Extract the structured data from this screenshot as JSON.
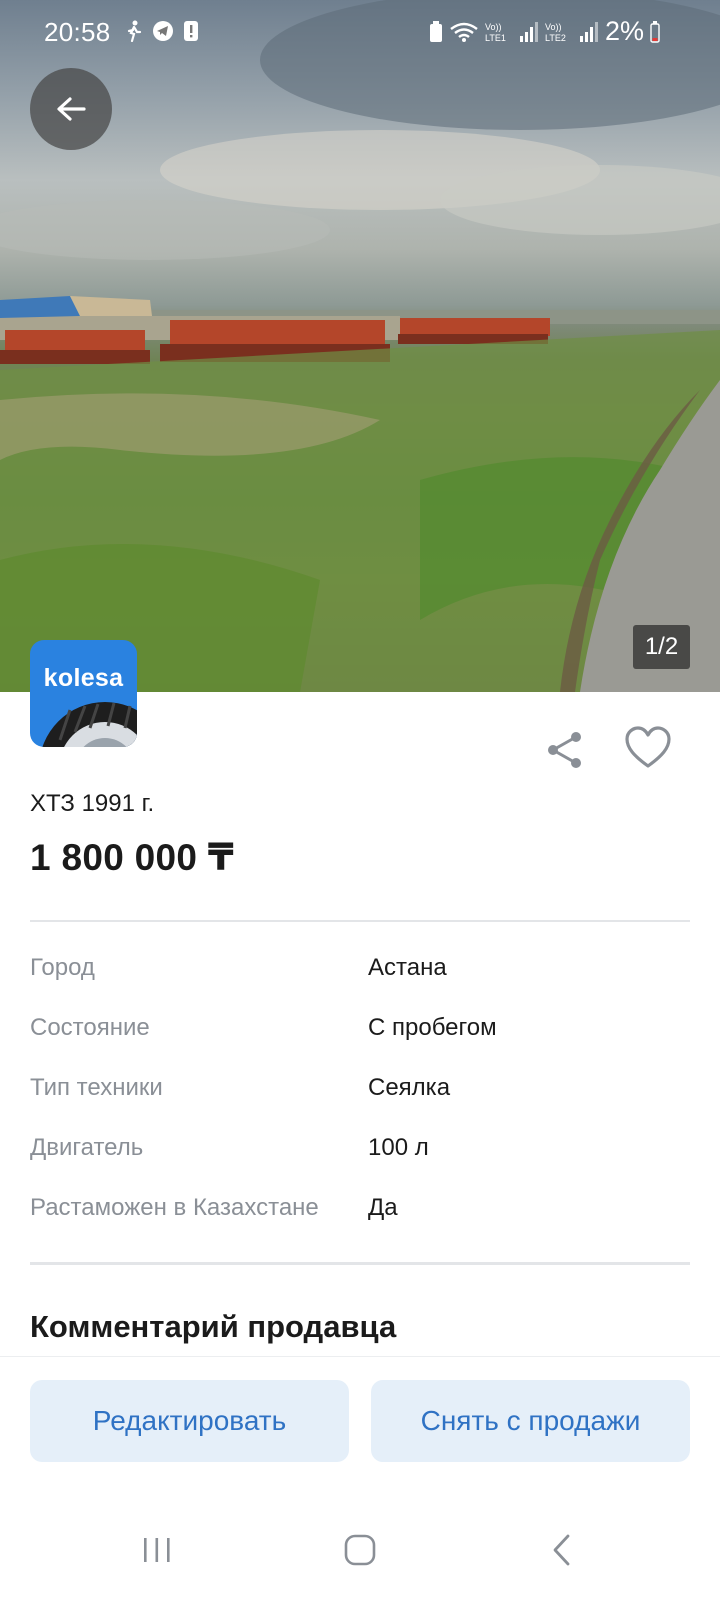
{
  "status_bar": {
    "time": "20:58",
    "battery": "2%"
  },
  "photo": {
    "counter": "1/2"
  },
  "brand": {
    "logo_text": "kolesa"
  },
  "listing": {
    "title": "ХТЗ 1991 г.",
    "price": "1 800 000 ₸",
    "specs": [
      {
        "label": "Город",
        "value": "Астана"
      },
      {
        "label": "Состояние",
        "value": "С пробегом"
      },
      {
        "label": "Тип техники",
        "value": "Сеялка"
      },
      {
        "label": "Двигатель",
        "value": "100 л"
      },
      {
        "label": "Растаможен в Казахстане",
        "value": "Да"
      }
    ],
    "comments_heading": "Комментарий продавца"
  },
  "actions": {
    "edit_label": "Редактировать",
    "remove_label": "Снять с продажи"
  },
  "icons": {
    "back": "arrow-left-icon",
    "share": "share-icon",
    "favorite": "heart-icon",
    "nav_recent": "recent-apps-icon",
    "nav_home": "home-icon",
    "nav_back": "chevron-left-icon"
  },
  "colors": {
    "accent": "#2f72c4",
    "button_bg": "#e5eff9",
    "logo_bg": "#2a82e0"
  }
}
